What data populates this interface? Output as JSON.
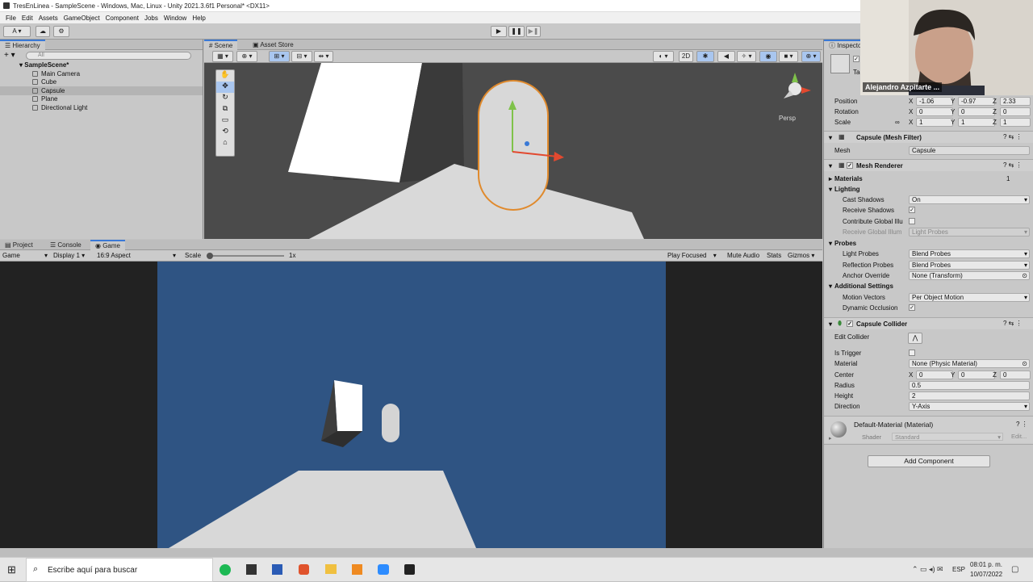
{
  "window": {
    "title": "TresEnLinea - SampleScene - Windows, Mac, Linux - Unity 2021.3.6f1 Personal* <DX11>"
  },
  "menu": [
    "File",
    "Edit",
    "Assets",
    "GameObject",
    "Component",
    "Jobs",
    "Window",
    "Help"
  ],
  "toolbar": {
    "account": "A"
  },
  "hierarchy": {
    "tab": "Hierarchy",
    "search_placeholder": "All",
    "scene": "SampleScene*",
    "items": [
      "Main Camera",
      "Cube",
      "Capsule",
      "Plane",
      "Directional Light"
    ]
  },
  "scene": {
    "tabs": [
      "Scene",
      "Asset Store"
    ],
    "toggle_2d": "2D",
    "persp": "Persp"
  },
  "game": {
    "tabs": [
      "Project",
      "Console",
      "Game"
    ],
    "dropdown": "Game",
    "display": "Display 1",
    "aspect": "16:9 Aspect",
    "scale_label": "Scale",
    "scale_value": "1x",
    "scale_level": 0,
    "play_focused": "Play Focused",
    "mute": "Mute Audio",
    "stats": "Stats",
    "gizmos": "Gizmos"
  },
  "inspector": {
    "tab": "Inspecto",
    "tag_label": "Tag",
    "transform": {
      "position_label": "Position",
      "rotation_label": "Rotation",
      "scale_label": "Scale",
      "position": {
        "x": "-1.06",
        "y": "-0.97",
        "z": "2.33"
      },
      "rotation": {
        "x": "0",
        "y": "0",
        "z": "0"
      },
      "scale": {
        "x": "1",
        "y": "1",
        "z": "1"
      }
    },
    "mesh_filter": {
      "title": "Capsule (Mesh Filter)",
      "mesh_label": "Mesh",
      "mesh_value": "Capsule"
    },
    "mesh_renderer": {
      "title": "Mesh Renderer",
      "materials_label": "Materials",
      "materials_count": "1",
      "lighting_label": "Lighting",
      "cast_shadows_label": "Cast Shadows",
      "cast_shadows": "On",
      "receive_shadows_label": "Receive Shadows",
      "contribute_gi_label": "Contribute Global Illu",
      "receive_gi_label": "Receive Global Illum",
      "receive_gi": "Light Probes",
      "probes_label": "Probes",
      "light_probes_label": "Light Probes",
      "light_probes": "Blend Probes",
      "reflection_probes_label": "Reflection Probes",
      "reflection_probes": "Blend Probes",
      "anchor_override_label": "Anchor Override",
      "anchor_override": "None (Transform)",
      "additional_label": "Additional Settings",
      "motion_vectors_label": "Motion Vectors",
      "motion_vectors": "Per Object Motion",
      "dynamic_occlusion_label": "Dynamic Occlusion"
    },
    "capsule_collider": {
      "title": "Capsule Collider",
      "edit_collider_label": "Edit Collider",
      "is_trigger_label": "Is Trigger",
      "material_label": "Material",
      "material": "None (Physic Material)",
      "center_label": "Center",
      "center": {
        "x": "0",
        "y": "0",
        "z": "0"
      },
      "radius_label": "Radius",
      "radius": "0.5",
      "height_label": "Height",
      "height": "2",
      "direction_label": "Direction",
      "direction": "Y-Axis"
    },
    "material": {
      "title": "Default-Material (Material)",
      "shader_label": "Shader",
      "shader": "Standard",
      "edit": "Edit..."
    },
    "add_component": "Add Component"
  },
  "webcam": {
    "name": "Alejandro Azpitarte ..."
  },
  "taskbar": {
    "search_placeholder": "Escribe aquí para buscar",
    "lang": "ESP",
    "time": "08:01 p. m.",
    "date": "10/07/2022"
  }
}
